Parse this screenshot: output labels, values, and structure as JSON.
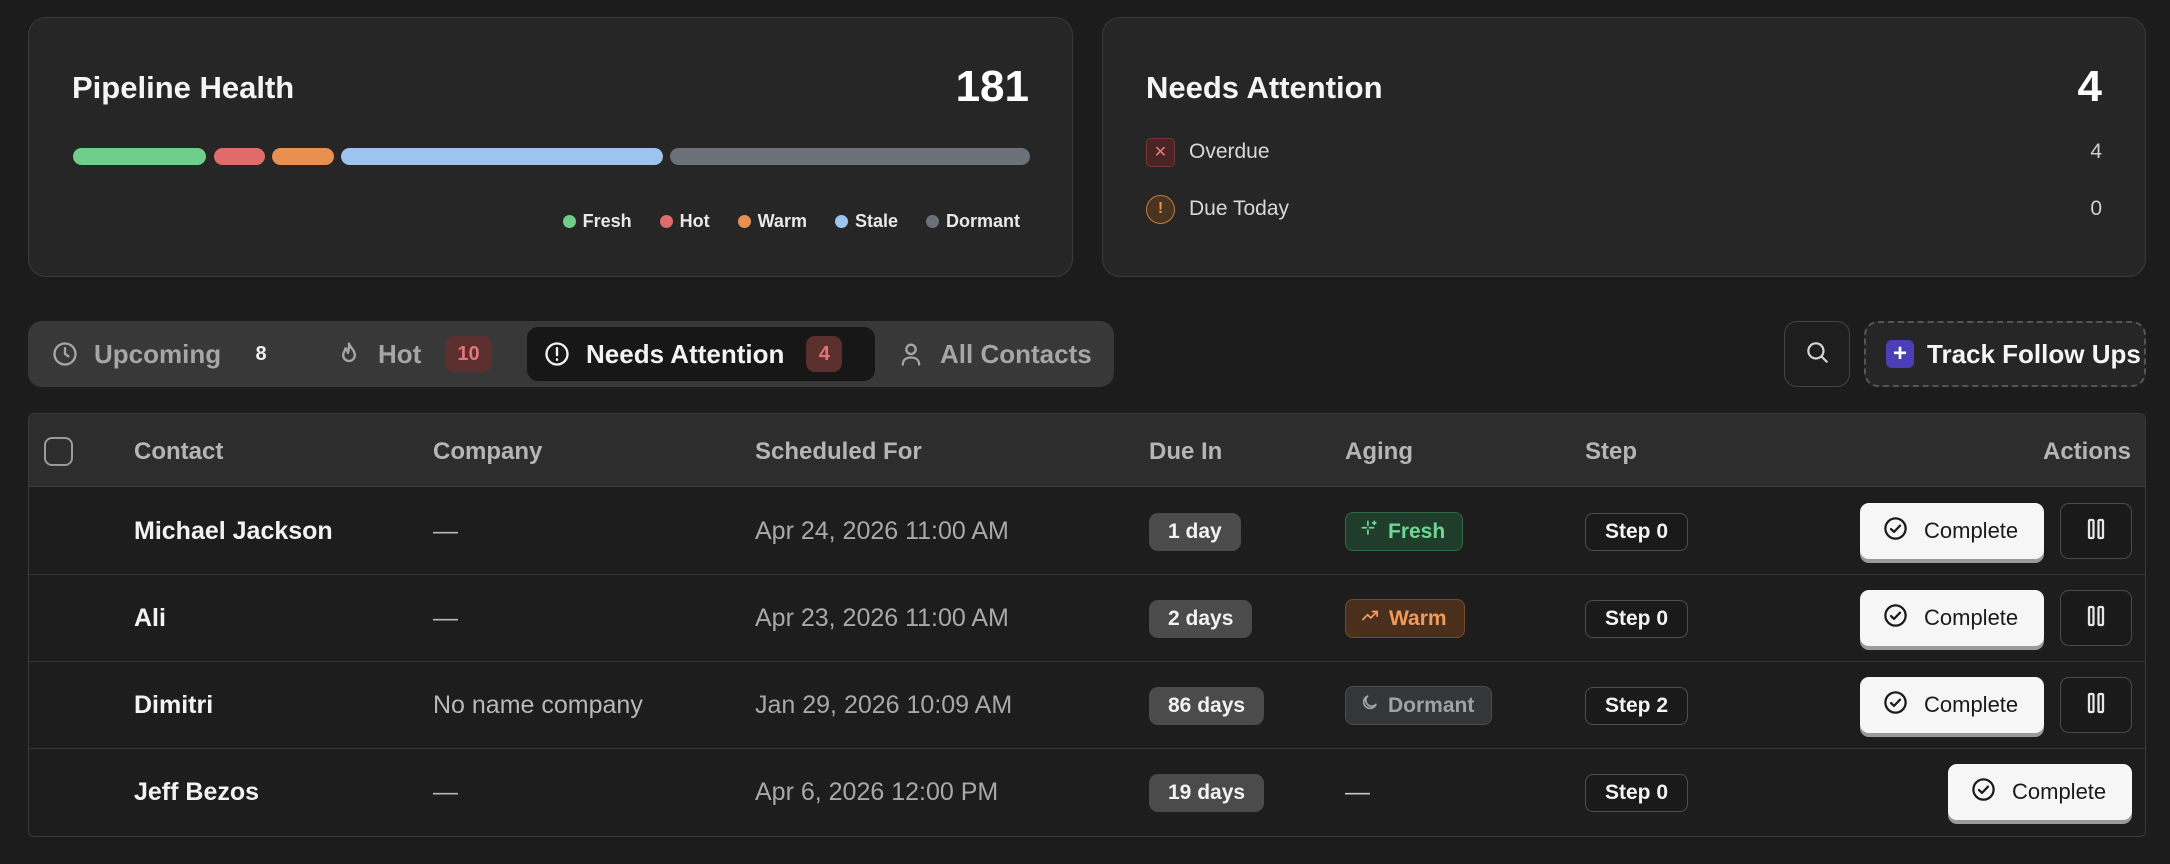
{
  "pipeline": {
    "title": "Pipeline Health",
    "total": "181",
    "segments": [
      {
        "name": "Fresh",
        "color": "#6fcf8a"
      },
      {
        "name": "Hot",
        "color": "#e06b6b"
      },
      {
        "name": "Warm",
        "color": "#e8904f"
      },
      {
        "name": "Stale",
        "color": "#9cc4ee"
      },
      {
        "name": "Dormant",
        "color": "#6c7078"
      }
    ]
  },
  "attention": {
    "title": "Needs Attention",
    "total": "4",
    "rows": [
      {
        "label": "Overdue",
        "count": "4",
        "icon": "x-icon"
      },
      {
        "label": "Due Today",
        "count": "0",
        "icon": "alert-circle-icon"
      }
    ]
  },
  "tabs": [
    {
      "label": "Upcoming",
      "count": "8",
      "icon": "clock-icon"
    },
    {
      "label": "Hot",
      "count": "10",
      "icon": "flame-icon"
    },
    {
      "label": "Needs Attention",
      "count": "4",
      "icon": "alert-circle-icon",
      "active": true
    },
    {
      "label": "All Contacts",
      "icon": "user-icon"
    }
  ],
  "toolbar": {
    "track_label": "Track Follow Ups"
  },
  "table": {
    "headers": {
      "contact": "Contact",
      "company": "Company",
      "scheduled": "Scheduled For",
      "due": "Due In",
      "aging": "Aging",
      "step": "Step",
      "actions": "Actions"
    },
    "complete_label": "Complete",
    "rows": [
      {
        "contact": "Michael Jackson",
        "company": "—",
        "scheduled": "Apr 24, 2026 11:00 AM",
        "due": "1 day",
        "aging": "Fresh",
        "step": "Step 0"
      },
      {
        "contact": "Ali",
        "company": "—",
        "scheduled": "Apr 23, 2026 11:00 AM",
        "due": "2 days",
        "aging": "Warm",
        "step": "Step 0"
      },
      {
        "contact": "Dimitri",
        "company": "No name company",
        "scheduled": "Jan 29, 2026 10:09 AM",
        "due": "86 days",
        "aging": "Dormant",
        "step": "Step 2"
      },
      {
        "contact": "Jeff Bezos",
        "company": "—",
        "scheduled": "Apr 6, 2026 12:00 PM",
        "due": "19 days",
        "aging": "—",
        "step": "Step 0"
      }
    ]
  }
}
